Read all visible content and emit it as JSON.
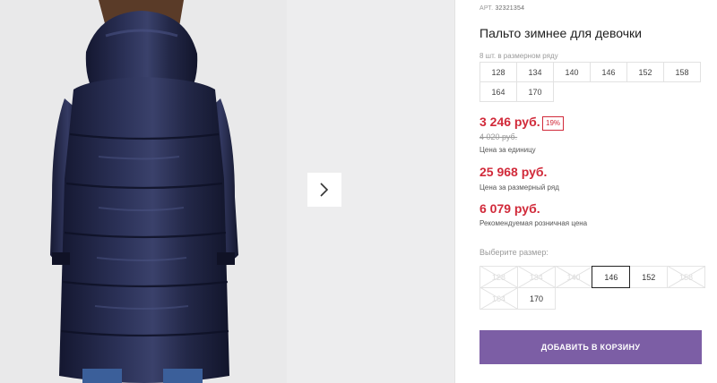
{
  "product": {
    "article_label": "АРТ.",
    "article": "32321354",
    "title": "Пальто зимнее для девочки"
  },
  "size_set": {
    "note": "8 шт. в размерном ряду",
    "sizes": [
      "128",
      "134",
      "140",
      "146",
      "152",
      "158",
      "164",
      "170"
    ]
  },
  "prices": {
    "unit_price": "3 246 руб.",
    "discount": "19%",
    "old_price": "4 020 руб.",
    "unit_caption": "Цена за единицу",
    "set_price": "25 968 руб.",
    "set_caption": "Цена за размерный ряд",
    "rrp_price": "6 079 руб.",
    "rrp_caption": "Рекомендуемая розничная цена"
  },
  "size_picker": {
    "label": "Выберите размер:",
    "options": [
      {
        "label": "128",
        "state": "unavailable"
      },
      {
        "label": "134",
        "state": "unavailable"
      },
      {
        "label": "140",
        "state": "unavailable"
      },
      {
        "label": "146",
        "state": "selected"
      },
      {
        "label": "152",
        "state": "available"
      },
      {
        "label": "158",
        "state": "unavailable"
      },
      {
        "label": "164",
        "state": "unavailable"
      },
      {
        "label": "170",
        "state": "available"
      }
    ]
  },
  "cart": {
    "add_label": "ДОБАВИТЬ В КОРЗИНУ"
  },
  "gallery": {
    "next_icon": "chevron-right-icon"
  },
  "colors": {
    "price_red": "#d12a3a",
    "button_purple": "#7c5ea5",
    "coat_navy": "#1d2140"
  }
}
